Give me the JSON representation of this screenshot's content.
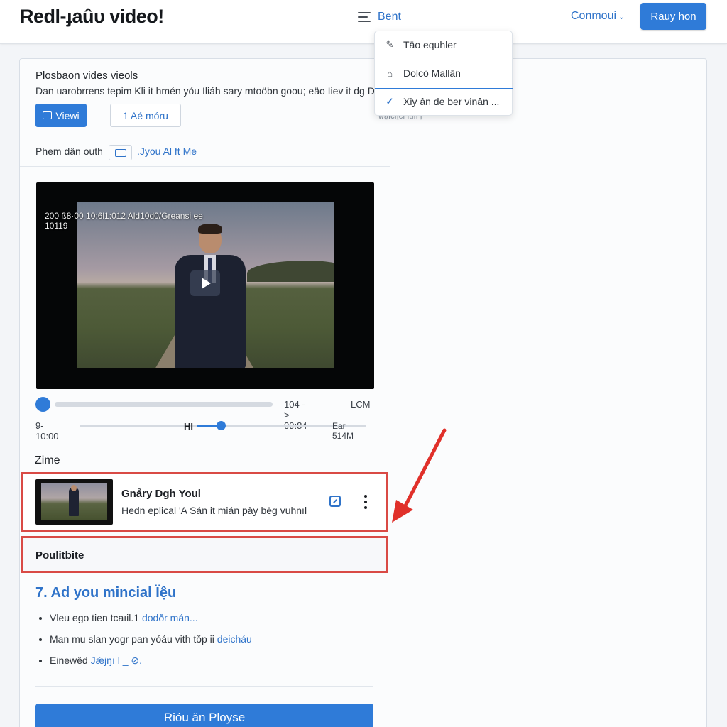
{
  "header": {
    "logo": "Redl-ɟaûυ video!",
    "menu_label": "Bent",
    "continue_label": "Conmoui",
    "primary_button": "Rauy hon"
  },
  "dropdown": {
    "items": [
      {
        "icon": "pencil-icon",
        "label": "Tāo equhler"
      },
      {
        "icon": "home-icon",
        "label": "Dolcö Mallān"
      },
      {
        "icon": "check-icon",
        "label": "Xiy ân de bẹr vinân ..."
      }
    ],
    "selected_index": 2
  },
  "card": {
    "title": "Plosbaon vides vieols",
    "description": "Dan uarobrrens tepim Kli it hmén yóu Iliáh sary mtoöbn goou; eäo Iiev it dg D",
    "sub_text": "wa̱ıcıı̱cı ıuıı ı̱",
    "view_button": "Viewi",
    "more_button": "1 Aé móru"
  },
  "filter": {
    "label": "Phem dän outh",
    "link": ".Jyou Al ft Me"
  },
  "video": {
    "overlay": "200 ß8·00 10:6l1:012 Ald10d0/Greansi ɵe\n10119",
    "time_info": "104 -> 09:84",
    "quality": "LCM",
    "time_start": "9- 10:00",
    "volume_icon": "HI",
    "time_end": "Ear 514M",
    "progress": 0.0,
    "volume": 0.5
  },
  "zone": {
    "title": "Zime"
  },
  "list_item": {
    "title": "Gnåry Dgh Youl",
    "description": "Hedn eplical 'A Sán it mián pày bēg vuhnıl"
  },
  "highlight_label": "Poulitbite",
  "section": {
    "title": "7. Ad you mincial Ïệu",
    "bullets": [
      {
        "text": "Vleu ego tien tcaıil.1 ",
        "link": "dodðr mán..."
      },
      {
        "text": "Man mu slan yogr pan yóáu vith tǒp ii ",
        "link": "deicháu"
      },
      {
        "text": "Einewëd ",
        "link": "Jǽjŋı l _ ⊘."
      }
    ]
  },
  "bottom_button": "Rióu än Ployse",
  "colors": {
    "accent": "#2f7bd8",
    "highlight": "#d94a45"
  }
}
